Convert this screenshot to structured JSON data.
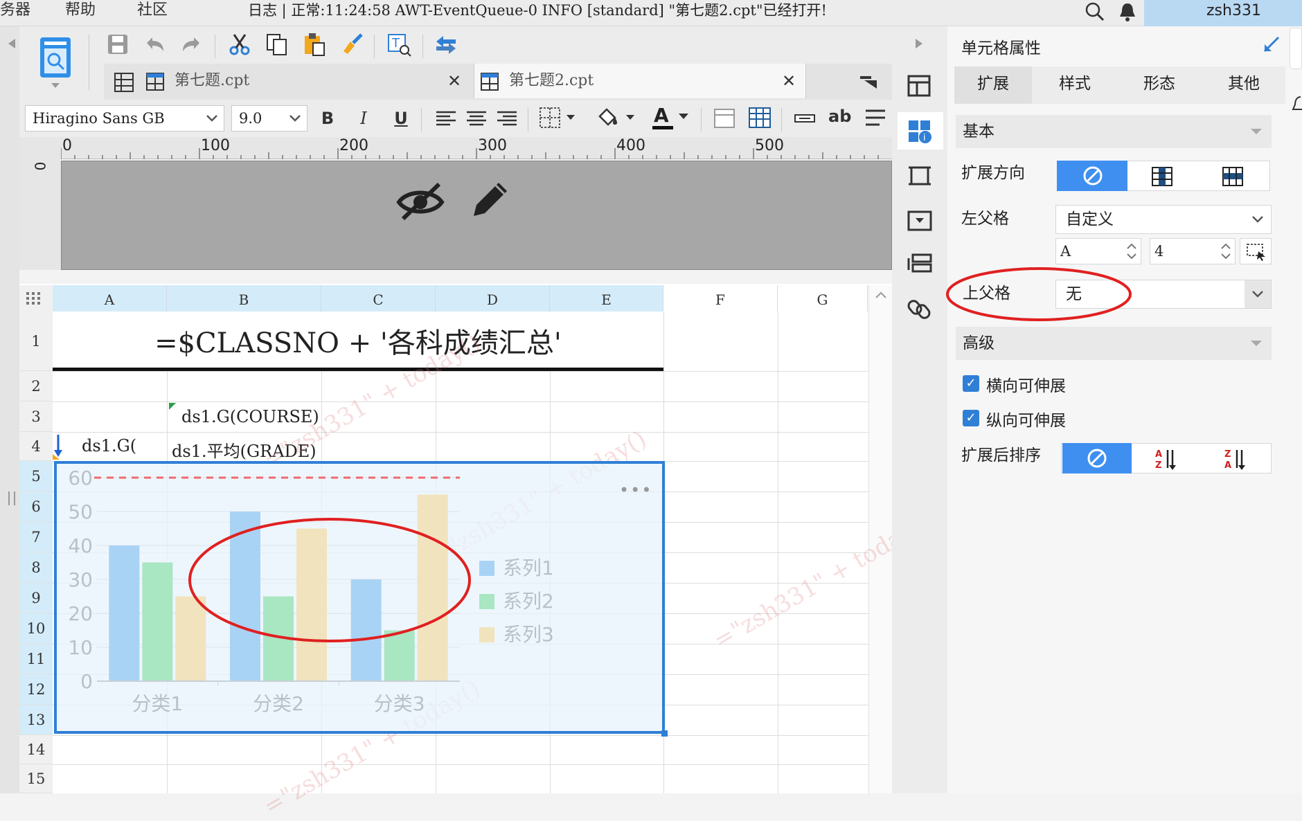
{
  "menu": {
    "item0": "务器",
    "item1": "帮助",
    "item2": "社区"
  },
  "status_bar": {
    "text": "日志 | 正常:11:24:58 AWT-EventQueue-0 INFO [standard] \"第七题2.cpt\"已经打开!"
  },
  "user": {
    "name": "zsh331"
  },
  "tabs": [
    {
      "label": "第七题.cpt"
    },
    {
      "label": "第七题2.cpt"
    }
  ],
  "format_bar": {
    "font": "Hiragino Sans GB",
    "size": "9.0",
    "bold": "B",
    "italic": "I",
    "underline": "U",
    "text_color_glyph": "A",
    "ab_label": "ab"
  },
  "ruler": {
    "marks": [
      "0",
      "100",
      "200",
      "300",
      "400",
      "500"
    ],
    "vmark": "0"
  },
  "sheet": {
    "columns": [
      "A",
      "B",
      "C",
      "D",
      "E",
      "F",
      "G"
    ],
    "rows": [
      "1",
      "2",
      "3",
      "4",
      "5",
      "6",
      "7",
      "8",
      "9",
      "10",
      "11",
      "12",
      "13",
      "14",
      "15"
    ],
    "title_formula": "=$CLASSNO + '各科成绩汇总'",
    "b3": "ds1.G(COURSE)",
    "a4": "ds1.G(",
    "b4": "ds1.平均(GRADE)",
    "watermark": "=\"zsh331\" + today()"
  },
  "chart_data": {
    "type": "bar",
    "categories": [
      "分类1",
      "分类2",
      "分类3"
    ],
    "series": [
      {
        "name": "系列1",
        "values": [
          40,
          50,
          30
        ],
        "color": "#a9d3f5"
      },
      {
        "name": "系列2",
        "values": [
          35,
          25,
          15
        ],
        "color": "#a9e6c2"
      },
      {
        "name": "系列3",
        "values": [
          25,
          45,
          55
        ],
        "color": "#f1e3bd"
      }
    ],
    "yticks": [
      "0",
      "10",
      "20",
      "30",
      "40",
      "50",
      "60"
    ],
    "ylim": [
      0,
      60
    ],
    "legend_position": "right",
    "reference_line": 60,
    "more_label": "•••"
  },
  "panel": {
    "title": "单元格属性",
    "tabs": [
      "扩展",
      "样式",
      "形态",
      "其他"
    ],
    "section_basic": "基本",
    "expand_dir_label": "扩展方向",
    "left_parent_label": "左父格",
    "left_parent_value": "自定义",
    "left_col": "A",
    "left_row": "4",
    "up_parent_label": "上父格",
    "up_parent_value": "无",
    "section_advanced": "高级",
    "h_expand": "横向可伸展",
    "v_expand": "纵向可伸展",
    "sort_label": "扩展后排序",
    "accent": "#3f8ff0",
    "annotation_color": "#e02020"
  }
}
